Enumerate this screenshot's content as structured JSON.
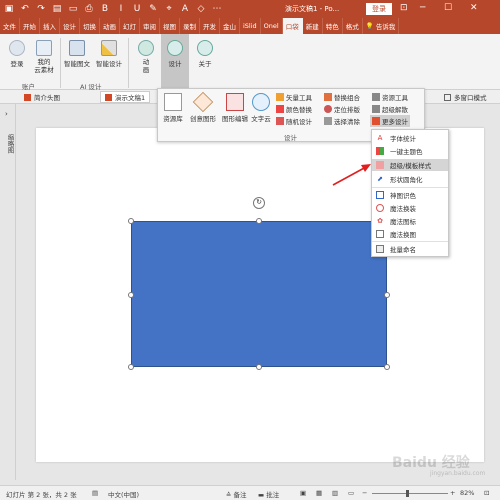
{
  "titlebar": {
    "title": "演示文稿1 - Po...",
    "login": "登录",
    "controls": [
      "─",
      "☐",
      "✕"
    ]
  },
  "tabs": [
    "文件",
    "开始",
    "插入",
    "设计",
    "切换",
    "动画",
    "幻灯",
    "审阅",
    "视图",
    "录制",
    "开发",
    "金山",
    "iSlid",
    "Onel",
    "口袋",
    "新建",
    "特色",
    "格式",
    "告诉我"
  ],
  "ribbon": {
    "login": "登录",
    "my_material": "我的\n云素材",
    "account_group": "账户",
    "smart_image": "智能图文",
    "smart_design": "智能设计",
    "ai_group": "AI 设计",
    "animation": "动\n画",
    "design": "设计",
    "about": "关于"
  },
  "doc_tabs": {
    "tab1": "简介头图",
    "tab2": "演示文稿1",
    "multiwindow": "多窗口模式"
  },
  "left_panel": {
    "label": "缩略图"
  },
  "design_panel": {
    "big_buttons": [
      "资源库",
      "创意图形",
      "图形编辑",
      "文字云"
    ],
    "col1": [
      "矢量工具",
      "颜色替换",
      "随机设计"
    ],
    "col2": [
      "替换组合",
      "定位排版",
      "选择清除"
    ],
    "col3": [
      "资源工具",
      "超级解散",
      "更多设计"
    ],
    "group_label": "设计"
  },
  "submenu": {
    "items": [
      "字体统计",
      "一键主题色",
      "超级/模板样式",
      "形状圆角化",
      "神图识色",
      "魔法换装",
      "魔法图标",
      "魔法换图",
      "批量命名"
    ],
    "highlighted_index": 2
  },
  "statusbar": {
    "slide_info": "幻灯片 第 2 张，共 2 张",
    "language": "中文(中国)",
    "notes": "备注",
    "comments": "批注",
    "zoom": "82%"
  },
  "watermark": {
    "text": "Baidu 经验",
    "sub": "jingyan.baidu.com"
  },
  "colors": {
    "accent": "#b7472a",
    "shape_fill": "#4472c4",
    "arrow": "#e02020"
  }
}
